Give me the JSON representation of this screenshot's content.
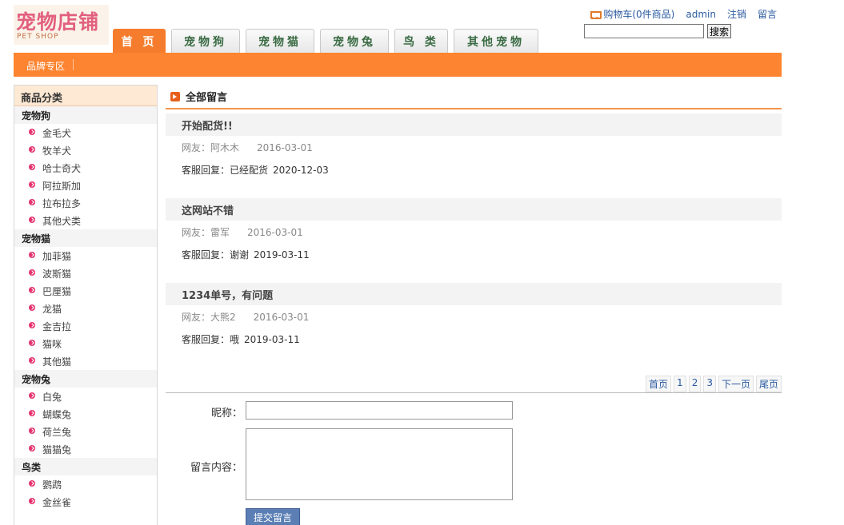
{
  "logo": {
    "title": "宠物店铺",
    "subtitle": "PET SHOP"
  },
  "toplinks": {
    "cart": "购物车(0件商品)",
    "user": "admin",
    "logout": "注销",
    "message": "留言"
  },
  "search": {
    "button": "搜索",
    "value": ""
  },
  "nav": [
    "首 页",
    "宠物狗",
    "宠物猫",
    "宠物兔",
    "鸟 类",
    "其他宠物"
  ],
  "brand_link": "品牌专区",
  "sidebar": {
    "heading": "商品分类",
    "categories": [
      {
        "name": "宠物狗",
        "items": [
          "金毛犬",
          "牧羊犬",
          "哈士奇犬",
          "阿拉斯加",
          "拉布拉多",
          "其他犬类"
        ]
      },
      {
        "name": "宠物猫",
        "items": [
          "加菲猫",
          "波斯猫",
          "巴厘猫",
          "龙猫",
          "金吉拉",
          "猫咪",
          "其他猫"
        ]
      },
      {
        "name": "宠物兔",
        "items": [
          "白兔",
          "蝴蝶兔",
          "荷兰兔",
          "猫猫兔"
        ]
      },
      {
        "name": "鸟类",
        "items": [
          "鹦鹉",
          "金丝雀"
        ]
      }
    ]
  },
  "main": {
    "title": "全部留言",
    "messages": [
      {
        "title": "开始配货!!",
        "user": "网友：阿木木",
        "date": "2016-03-01",
        "reply": "客服回复：已经配货",
        "reply_date": "2020-12-03"
      },
      {
        "title": "这网站不错",
        "user": "网友：雷军",
        "date": "2016-03-01",
        "reply": "客服回复：谢谢",
        "reply_date": "2019-03-11"
      },
      {
        "title": "1234单号，有问题",
        "user": "网友：大熊2",
        "date": "2016-03-01",
        "reply": "客服回复：哦",
        "reply_date": "2019-03-11"
      }
    ],
    "pager": [
      "首页",
      "1",
      "2",
      "3",
      "下一页",
      "尾页"
    ],
    "form": {
      "nick_label": "昵称：",
      "content_label": "留言内容：",
      "submit": "提交留言"
    }
  }
}
